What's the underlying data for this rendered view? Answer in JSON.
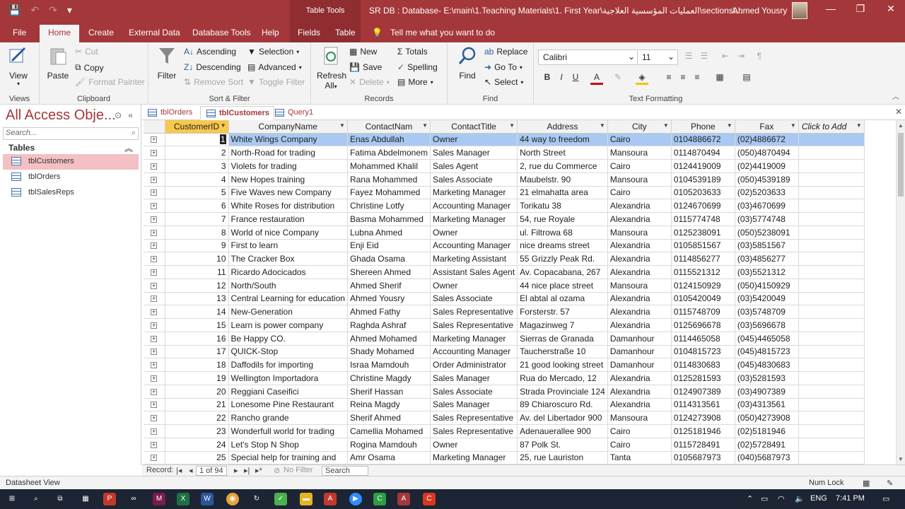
{
  "titlebar": {
    "context_label": "Table Tools",
    "title": "SR DB : Database- E:\\main\\1.Teaching Materials\\1. First Year\\العمليات المؤسسية العلاجية\\sections\\...",
    "user": "Ahmed Yousry",
    "minimize": "—",
    "restore": "❐",
    "close": "✕"
  },
  "tabs": [
    "File",
    "Home",
    "Create",
    "External Data",
    "Database Tools",
    "Help",
    "Fields",
    "Table"
  ],
  "tell_me": "Tell me what you want to do",
  "ribbon": {
    "views": {
      "view": "View",
      "group": "Views"
    },
    "clipboard": {
      "paste": "Paste",
      "cut": "Cut",
      "copy": "Copy",
      "format_painter": "Format Painter",
      "group": "Clipboard"
    },
    "sort_filter": {
      "filter": "Filter",
      "ascending": "Ascending",
      "descending": "Descending",
      "remove_sort": "Remove Sort",
      "selection": "Selection",
      "advanced": "Advanced",
      "toggle_filter": "Toggle Filter",
      "group": "Sort & Filter"
    },
    "records": {
      "refresh": "Refresh",
      "refresh_all": "All",
      "new": "New",
      "save": "Save",
      "delete": "Delete",
      "totals": "Totals",
      "spelling": "Spelling",
      "more": "More",
      "group": "Records"
    },
    "find": {
      "find": "Find",
      "replace": "Replace",
      "goto": "Go To",
      "select": "Select",
      "group": "Find"
    },
    "text_formatting": {
      "font": "Calibri",
      "size": "11",
      "bold": "B",
      "italic": "I",
      "underline": "U",
      "font_color": "A",
      "group": "Text Formatting"
    }
  },
  "nav": {
    "title": "All Access Obje...",
    "search_placeholder": "Search...",
    "section": "Tables",
    "items": [
      "tblCustomers",
      "tblOrders",
      "tblSalesReps"
    ]
  },
  "doctabs": [
    "tblOrders",
    "tblCustomers",
    "Query1"
  ],
  "grid": {
    "columns": [
      "CustomerID",
      "CompanyName",
      "ContactNam",
      "ContactTitle",
      "Address",
      "City",
      "Phone",
      "Fax",
      "Click to Add"
    ],
    "rows": [
      [
        "1",
        "White Wings Company",
        "Enas Abdullah",
        "Owner",
        "44 way to freedom",
        "Cairo",
        "0104886672",
        "(02)4886672"
      ],
      [
        "2",
        "North-Road for trading",
        "Fatima Abdelmonem",
        "Sales Manager",
        "North Street",
        "Mansoura",
        "0114870494",
        "(050)4870494"
      ],
      [
        "3",
        "Violets for trading",
        "Mohammed Khalil",
        "Sales Agent",
        "2, rue du Commerce",
        "Cairo",
        "0124419009",
        "(02)4419009"
      ],
      [
        "4",
        "New Hopes training",
        "Rana Mohammed",
        "Sales Associate",
        "Maubelstr. 90",
        "Mansoura",
        "0104539189",
        "(050)4539189"
      ],
      [
        "5",
        "Five Waves new Company",
        "Fayez Mohammed",
        "Marketing Manager",
        "21 elmahatta area",
        "Cairo",
        "0105203633",
        "(02)5203633"
      ],
      [
        "6",
        "White Roses for distribution",
        "Christine Lotfy",
        "Accounting Manager",
        "Torikatu 38",
        "Alexandria",
        "0124670699",
        "(03)4670699"
      ],
      [
        "7",
        "France restauration",
        "Basma Mohammed",
        "Marketing Manager",
        "54, rue Royale",
        "Alexandria",
        "0115774748",
        "(03)5774748"
      ],
      [
        "8",
        "World of nice Company",
        "Lubna Ahmed",
        "Owner",
        "ul. Filtrowa 68",
        "Mansoura",
        "0125238091",
        "(050)5238091"
      ],
      [
        "9",
        "First to learn",
        "Enji Eid",
        "Accounting Manager",
        "nice dreams street",
        "Alexandria",
        "0105851567",
        "(03)5851567"
      ],
      [
        "10",
        "The Cracker Box",
        "Ghada Osama",
        "Marketing Assistant",
        "55 Grizzly Peak Rd.",
        "Alexandria",
        "0114856277",
        "(03)4856277"
      ],
      [
        "11",
        "Ricardo Adocicados",
        "Shereen Ahmed",
        "Assistant Sales Agent",
        "Av. Copacabana, 267",
        "Alexandria",
        "0115521312",
        "(03)5521312"
      ],
      [
        "12",
        "North/South",
        "Ahmed Sherif",
        "Owner",
        "44 nice place street",
        "Mansoura",
        "0124150929",
        "(050)4150929"
      ],
      [
        "13",
        "Central Learning for education",
        "Ahmed Yousry",
        "Sales Associate",
        "El abtal al ozama",
        "Alexandria",
        "0105420049",
        "(03)5420049"
      ],
      [
        "14",
        "New-Generation",
        "Ahmed Fathy",
        "Sales Representative",
        "Forsterstr. 57",
        "Alexandria",
        "0115748709",
        "(03)5748709"
      ],
      [
        "15",
        "Learn is power company",
        "Raghda Ashraf",
        "Sales Representative",
        "Magazinweg 7",
        "Alexandria",
        "0125696678",
        "(03)5696678"
      ],
      [
        "16",
        "Be Happy CO.",
        "Ahmed Mohamed",
        "Marketing Manager",
        "Sierras de Granada",
        "Damanhour",
        "0114465058",
        "(045)4465058"
      ],
      [
        "17",
        "QUICK-Stop",
        "Shady Mohamed",
        "Accounting Manager",
        "Taucherstraße 10",
        "Damanhour",
        "0104815723",
        "(045)4815723"
      ],
      [
        "18",
        "Daffodils for importing",
        "Israa Mamdouh",
        "Order Administrator",
        "21 good looking street",
        "Damanhour",
        "0114830683",
        "(045)4830683"
      ],
      [
        "19",
        "Wellington Importadora",
        "Christine Magdy",
        "Sales Manager",
        "Rua do Mercado, 12",
        "Alexandria",
        "0125281593",
        "(03)5281593"
      ],
      [
        "20",
        "Reggiani Caseifici",
        "Sherif Hassan",
        "Sales Associate",
        "Strada Provinciale 124",
        "Alexandria",
        "0124907389",
        "(03)4907389"
      ],
      [
        "21",
        "Lonesome Pine Restaurant",
        "Reina Magdy",
        "Sales Manager",
        "89 Chiaroscuro Rd.",
        "Alexandria",
        "0114313561",
        "(03)4313561"
      ],
      [
        "22",
        "Rancho grande",
        "Sherif Ahmed",
        "Sales Representative",
        "Av. del Libertador 900",
        "Mansoura",
        "0124273908",
        "(050)4273908"
      ],
      [
        "23",
        "Wonderfull world for trading",
        "Camellia Mohamed",
        "Sales Representative",
        "Adenauerallee 900",
        "Cairo",
        "0125181946",
        "(02)5181946"
      ],
      [
        "24",
        "Let's Stop N Shop",
        "Rogina Mamdouh",
        "Owner",
        "87 Polk St.",
        "Cairo",
        "0115728491",
        "(02)5728491"
      ],
      [
        "25",
        "Special help for training and",
        "Amr Osama",
        "Marketing Manager",
        "25, rue Lauriston",
        "Tanta",
        "0105687973",
        "(040)5687973"
      ]
    ]
  },
  "recnav": {
    "label": "Record:",
    "position": "1 of 94",
    "no_filter": "No Filter",
    "search": "Search"
  },
  "status": {
    "left": "Datasheet View",
    "numlock": "Num Lock"
  },
  "taskbar": {
    "lang": "ENG",
    "time": "7:41 PM"
  },
  "colors": {
    "accent": "#a4373a",
    "selected_row": "#a9c9f2",
    "selected_header": "#f7c84e"
  }
}
